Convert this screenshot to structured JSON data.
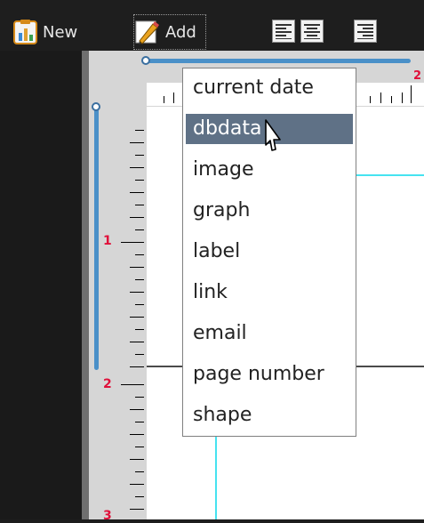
{
  "toolbar": {
    "new_label": "New",
    "new_icon": "report-chart-icon",
    "add_label": "Add",
    "add_icon": "pencil-icon",
    "align_buttons": [
      "align-left-icon",
      "align-center-icon",
      "align-right-icon"
    ]
  },
  "rulers": {
    "horizontal_numbers": [
      "2"
    ],
    "vertical_numbers": [
      "1",
      "2",
      "3"
    ]
  },
  "add_menu": {
    "items": [
      "current date",
      "dbdata",
      "image",
      "graph",
      "label",
      "link",
      "email",
      "page number",
      "shape"
    ],
    "selected": "dbdata"
  },
  "colors": {
    "toolbar_bg": "#1e1e1e",
    "menu_selection": "#5f7186",
    "ruler_number": "#e0103a",
    "guide_blue": "#4a90c8",
    "guide_cyan": "#46e3f0"
  }
}
